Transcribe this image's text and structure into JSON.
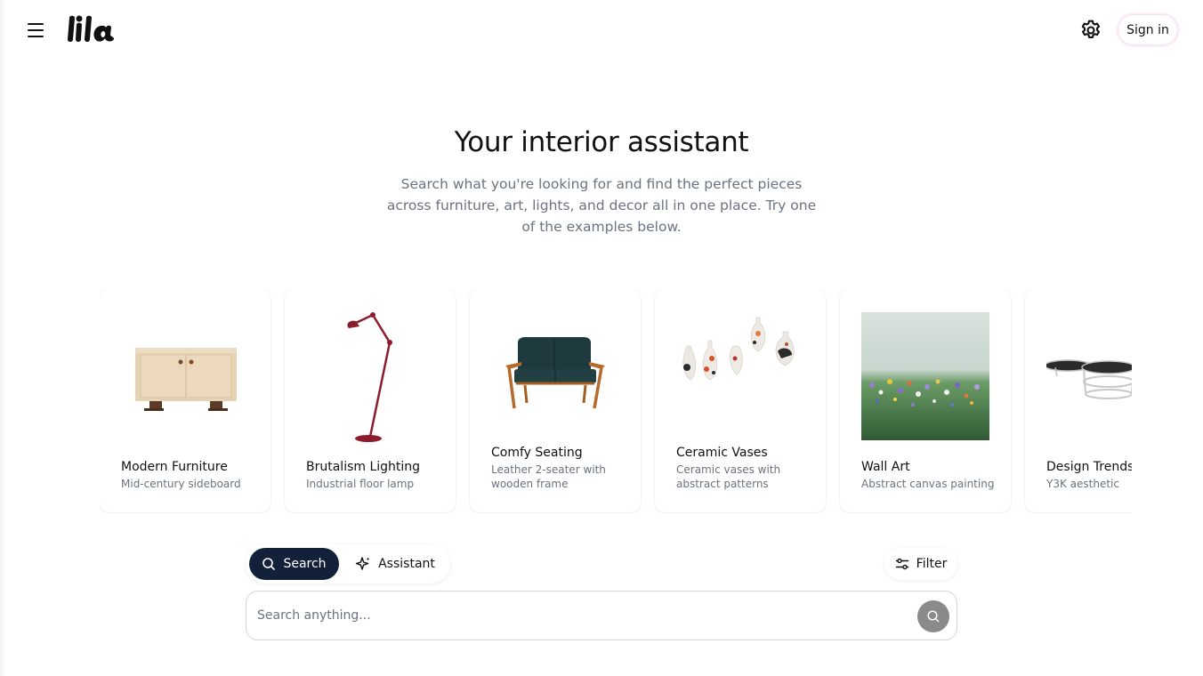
{
  "header": {
    "menu_icon": "hamburger-menu-icon",
    "logo_text": "lila",
    "settings_icon": "gear-icon",
    "signin_label": "Sign in"
  },
  "hero": {
    "title": "Your interior assistant",
    "subtitle": "Search what you're looking for and find the perfect pieces across furniture, art, lights, and decor all in one place. Try one of the examples below."
  },
  "examples": [
    {
      "title": "Modern Furniture",
      "desc": "Mid-century sideboard",
      "image": "sideboard"
    },
    {
      "title": "Brutalism Lighting",
      "desc": "Industrial floor lamp",
      "image": "floor-lamp"
    },
    {
      "title": "Comfy Seating",
      "desc": "Leather 2-seater with wooden frame",
      "image": "loveseat"
    },
    {
      "title": "Ceramic Vases",
      "desc": "Ceramic vases with abstract patterns",
      "image": "vases"
    },
    {
      "title": "Wall Art",
      "desc": "Abstract canvas painting",
      "image": "painting"
    },
    {
      "title": "Design Trends",
      "desc": "Y3K aesthetic",
      "image": "chrome-tables"
    }
  ],
  "modes": {
    "search_label": "Search",
    "assistant_label": "Assistant",
    "active": "Search"
  },
  "filter_label": "Filter",
  "search": {
    "placeholder": "Search anything...",
    "value": ""
  },
  "colors": {
    "active_mode_bg": "#13203a",
    "submit_bg": "#8a8a8a",
    "muted_text": "#6b7280"
  }
}
